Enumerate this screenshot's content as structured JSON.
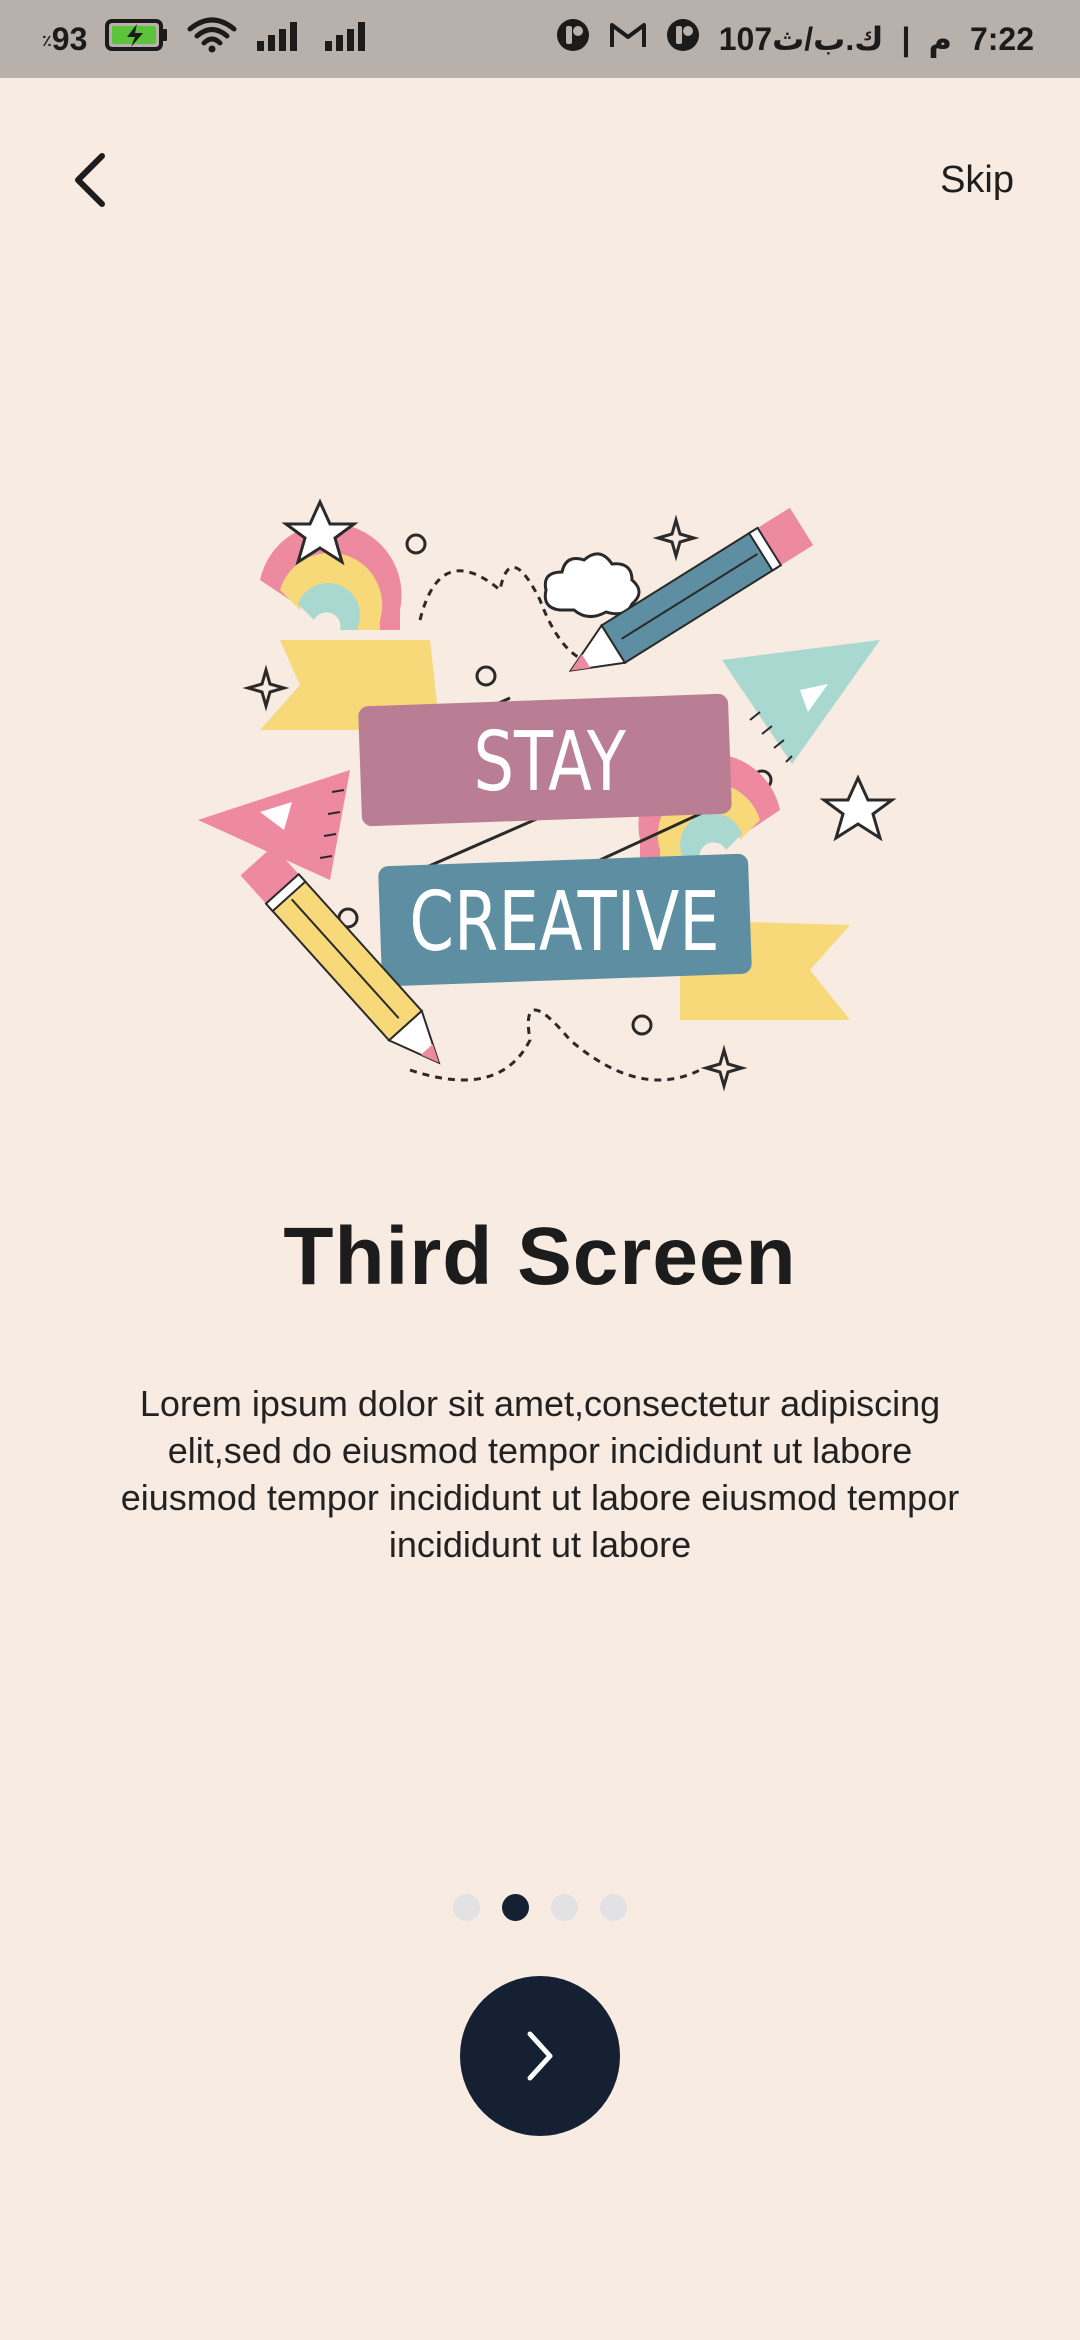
{
  "status_bar": {
    "battery_percent": "93",
    "battery_unit": "٪",
    "network_text": "107ك.ب/ث",
    "separator": "|",
    "ampm": "م",
    "time": "7:22"
  },
  "nav": {
    "skip_label": "Skip"
  },
  "illustration": {
    "banner_top": "STAY",
    "banner_bottom": "CREATIVE"
  },
  "content": {
    "title": "Third Screen",
    "description": "Lorem ipsum dolor sit amet,consectetur adipiscing elit,sed do eiusmod tempor incididunt ut labore eiusmod tempor incididunt ut labore eiusmod tempor incididunt ut labore"
  },
  "pagination": {
    "total": 4,
    "active_index": 1
  },
  "colors": {
    "background": "#f7ebe2",
    "accent": "#152033",
    "dot_inactive": "#e2e2e4"
  }
}
